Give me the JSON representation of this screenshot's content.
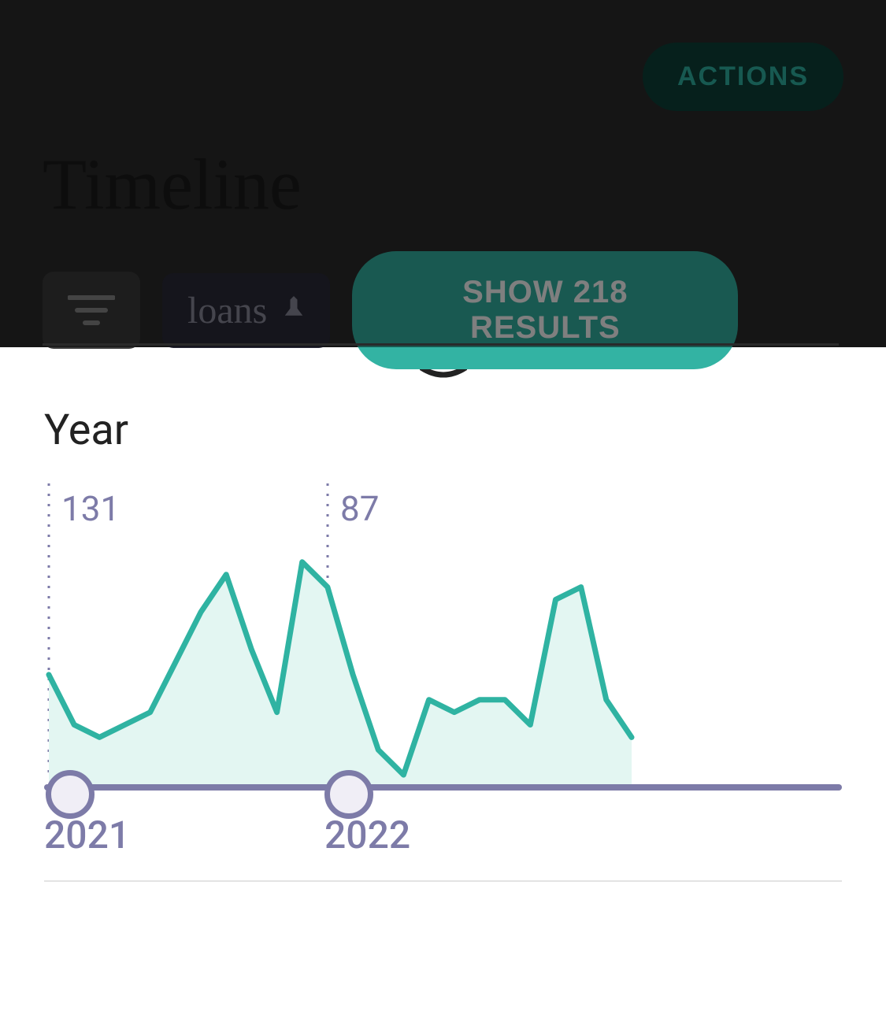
{
  "header": {
    "actions_label": "ACTIONS",
    "page_title": "Timeline"
  },
  "controls": {
    "tag_label": "loans",
    "show_results_label": "SHOW 218 RESULTS"
  },
  "sheet": {
    "title": "Year",
    "count_2021": "131",
    "count_2022": "87",
    "axis_2021": "2021",
    "axis_2022": "2022"
  },
  "chart_data": {
    "type": "area",
    "xlabel": "",
    "ylabel": "",
    "ylim": [
      0,
      20
    ],
    "series": [
      {
        "name": "2021",
        "total": 131,
        "x": [
          1,
          2,
          3,
          4,
          5,
          6,
          7,
          8,
          9,
          10,
          11,
          12
        ],
        "values": [
          9,
          5,
          4,
          5,
          6,
          10,
          14,
          17,
          11,
          6,
          18,
          16
        ]
      },
      {
        "name": "2022",
        "total": 87,
        "x": [
          1,
          2,
          3,
          4,
          5,
          6,
          7,
          8,
          9,
          10,
          11,
          12
        ],
        "values": [
          9,
          3,
          1,
          7,
          6,
          7,
          7,
          5,
          15,
          16,
          7,
          4
        ]
      }
    ],
    "categories": [
      "2021",
      "2022"
    ]
  }
}
